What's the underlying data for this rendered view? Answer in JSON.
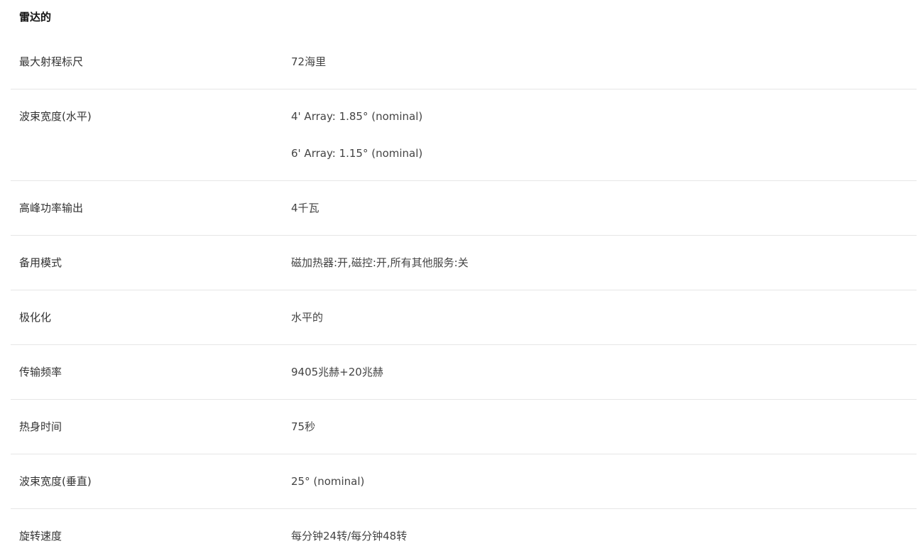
{
  "section": {
    "title": "雷达的"
  },
  "specs": [
    {
      "label": "最大射程标尺",
      "values": [
        "72海里"
      ]
    },
    {
      "label": "波束宽度(水平)",
      "values": [
        "4' Array: 1.85° (nominal)",
        "6' Array: 1.15° (nominal)"
      ]
    },
    {
      "label": "高峰功率输出",
      "values": [
        "4千瓦"
      ]
    },
    {
      "label": "备用模式",
      "values": [
        "磁加热器:开,磁控:开,所有其他服务:关"
      ]
    },
    {
      "label": "极化化",
      "values": [
        "水平的"
      ]
    },
    {
      "label": "传输频率",
      "values": [
        "9405兆赫+20兆赫"
      ]
    },
    {
      "label": "热身时间",
      "values": [
        "75秒"
      ]
    },
    {
      "label": "波束宽度(垂直)",
      "values": [
        "25° (nominal)"
      ]
    },
    {
      "label": "旋转速度",
      "values": [
        "每分钟24转/每分钟48转"
      ]
    }
  ]
}
